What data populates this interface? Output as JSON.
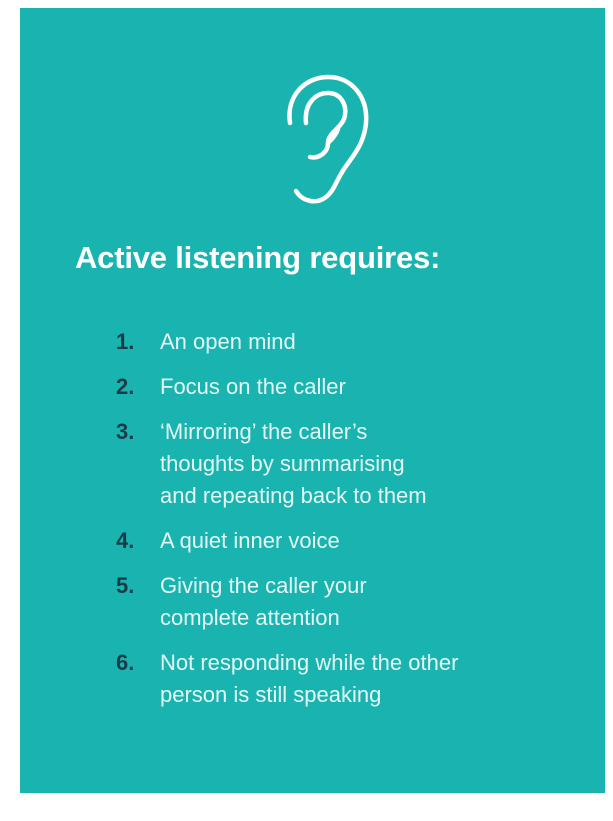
{
  "colors": {
    "background": "#1ab4b0",
    "number": "#173b48",
    "text": "#ffffff"
  },
  "icon": "ear-icon",
  "title": "Active listening requires:",
  "items": [
    {
      "number": "1.",
      "lines": [
        "An open mind"
      ]
    },
    {
      "number": "2.",
      "lines": [
        "Focus on the caller"
      ]
    },
    {
      "number": "3.",
      "lines": [
        "‘Mirroring’ the caller’s",
        "thoughts by summarising",
        "and repeating back to them"
      ]
    },
    {
      "number": "4.",
      "lines": [
        "A quiet inner voice"
      ]
    },
    {
      "number": "5.",
      "lines": [
        "Giving the caller your",
        "complete attention"
      ]
    },
    {
      "number": "6.",
      "lines": [
        "Not responding while the other",
        "person is still speaking"
      ]
    }
  ]
}
